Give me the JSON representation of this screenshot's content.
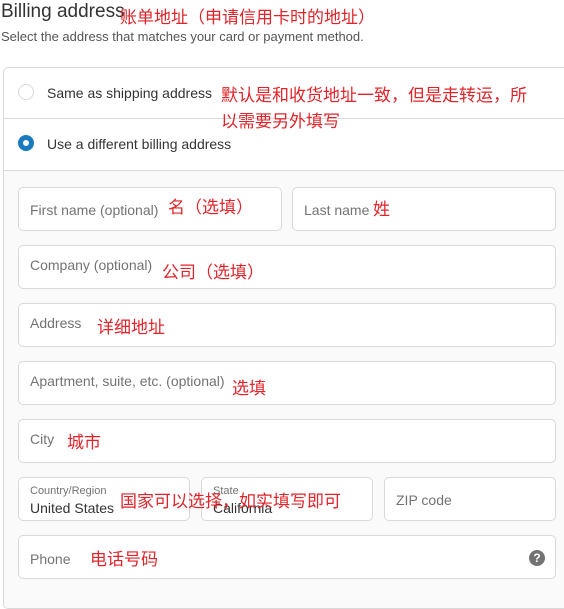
{
  "header": {
    "title": "Billing address",
    "subtitle": "Select the address that matches your card or payment method."
  },
  "options": {
    "same_label": "Same as shipping address",
    "different_label": "Use a different billing address",
    "selected": "different"
  },
  "form": {
    "first_name_placeholder": "First name (optional)",
    "last_name_placeholder": "Last name",
    "company_placeholder": "Company (optional)",
    "address_placeholder": "Address",
    "apartment_placeholder": "Apartment, suite, etc. (optional)",
    "city_placeholder": "City",
    "country_label": "Country/Region",
    "country_value": "United States",
    "state_label": "State",
    "state_value": "California",
    "zip_placeholder": "ZIP code",
    "phone_placeholder": "Phone",
    "help_glyph": "?"
  },
  "annotations": {
    "title_note": "账单地址（申请信用卡时的地址）",
    "same_note_line1": "默认是和收货地址一致，但是走转运，所",
    "same_note_line2": "以需要另外填写",
    "first_name_note": "名（选填）",
    "last_name_note": "姓",
    "company_note": "公司（选填）",
    "address_note": "详细地址",
    "apartment_note": "选填",
    "city_note": "城市",
    "country_state_note": "国家可以选择，如实填写即可",
    "phone_note": "电话号码"
  },
  "colors": {
    "accent": "#197bbd",
    "annotation": "#e0242a"
  }
}
